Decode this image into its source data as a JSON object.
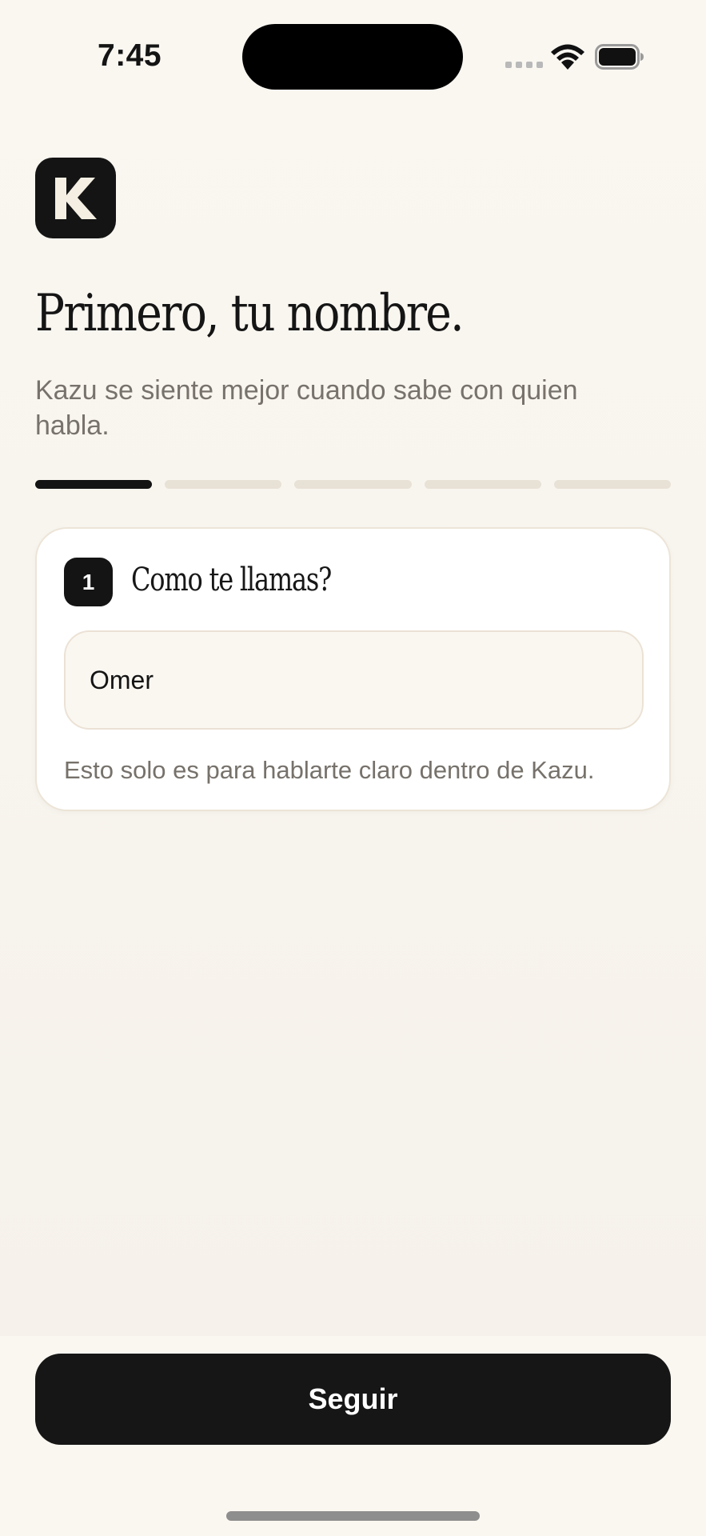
{
  "status_bar": {
    "time": "7:45",
    "icons": [
      "signal-dots-icon",
      "wifi-icon",
      "battery-icon"
    ]
  },
  "logo": {
    "letter": "K",
    "icon": "kazu-logo-icon"
  },
  "header": {
    "title": "Primero, tu nombre.",
    "subtitle": "Kazu se siente mejor cuando sabe con quien habla."
  },
  "progress": {
    "total_steps": 5,
    "current_step": 1
  },
  "question_card": {
    "step_number": "1",
    "question": "Como te llamas?",
    "input_value": "Omer",
    "hint": "Esto solo es para hablarte claro dentro de Kazu."
  },
  "footer": {
    "button_label": "Seguir"
  },
  "colors": {
    "background": "#f7f3ec",
    "ink": "#141414",
    "muted_text": "#77726b",
    "progress_inactive": "#e8e1d6",
    "card_border": "#ece4d7"
  }
}
